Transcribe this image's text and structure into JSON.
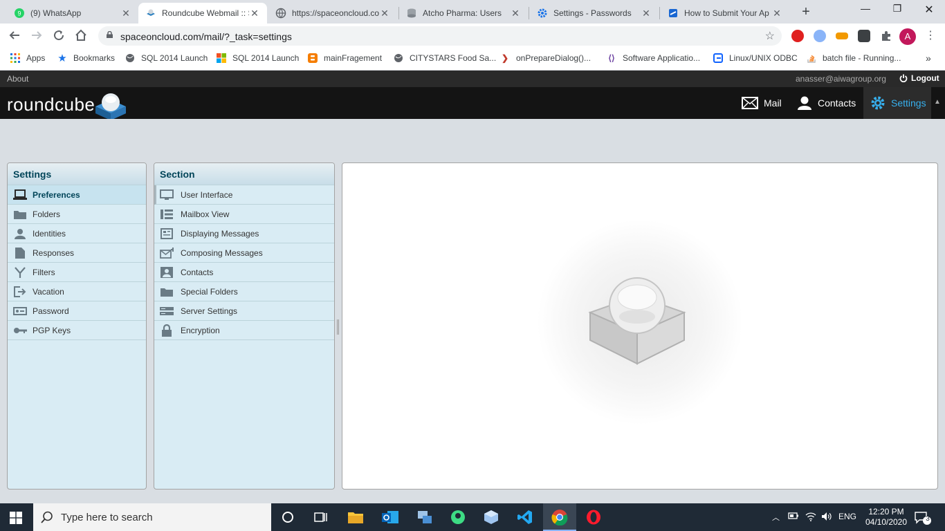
{
  "browser": {
    "tabs": [
      {
        "title": "(9) WhatsApp",
        "close": "✕"
      },
      {
        "title": "Roundcube Webmail :: S",
        "close": "✕"
      },
      {
        "title": "https://spaceoncloud.co",
        "close": "✕"
      },
      {
        "title": "Atcho Pharma: Users",
        "close": "✕"
      },
      {
        "title": "Settings - Passwords",
        "close": "✕"
      },
      {
        "title": "How to Submit Your Ap",
        "close": "✕"
      }
    ],
    "new_tab": "+",
    "window_controls": {
      "minimize": "—",
      "restore": "❐",
      "close": "✕"
    },
    "url": "spaceoncloud.com/mail/?_task=settings",
    "profile_initial": "A",
    "bookmarks": [
      {
        "label": "Apps",
        "icon": "apps-grid-icon"
      },
      {
        "label": "Bookmarks",
        "icon": "star-icon"
      },
      {
        "label": "SQL 2014 Launch",
        "icon": "globe-icon"
      },
      {
        "label": "SQL 2014 Launch",
        "icon": "windows-logo-icon"
      },
      {
        "label": "mainFragement",
        "icon": "blogger-icon"
      },
      {
        "label": "CITYSTARS Food Sa...",
        "icon": "globe-icon"
      },
      {
        "label": "onPrepareDialog()...",
        "icon": "android-icon"
      },
      {
        "label": "Software Applicatio...",
        "icon": "code-icon"
      },
      {
        "label": "Linux/UNIX ODBC",
        "icon": "ibm-icon"
      },
      {
        "label": "batch file - Running...",
        "icon": "stackoverflow-icon"
      }
    ],
    "bookmarks_more": "»"
  },
  "roundcube": {
    "about": "About",
    "user_email": "anasser@aiwagroup.org",
    "logout": "Logout",
    "logo_text": "roundcube",
    "nav": [
      {
        "label": "Mail",
        "icon": "envelope-icon"
      },
      {
        "label": "Contacts",
        "icon": "user-icon"
      },
      {
        "label": "Settings",
        "icon": "gear-icon",
        "selected": true
      }
    ],
    "settings_panel": {
      "title": "Settings",
      "items": [
        {
          "label": "Preferences",
          "icon": "laptop-icon",
          "selected": true
        },
        {
          "label": "Folders",
          "icon": "folder-icon"
        },
        {
          "label": "Identities",
          "icon": "person-icon"
        },
        {
          "label": "Responses",
          "icon": "document-icon"
        },
        {
          "label": "Filters",
          "icon": "filter-icon"
        },
        {
          "label": "Vacation",
          "icon": "exit-icon"
        },
        {
          "label": "Password",
          "icon": "password-icon"
        },
        {
          "label": "PGP Keys",
          "icon": "key-icon"
        }
      ]
    },
    "section_panel": {
      "title": "Section",
      "items": [
        {
          "label": "User Interface",
          "icon": "monitor-icon"
        },
        {
          "label": "Mailbox View",
          "icon": "list-view-icon"
        },
        {
          "label": "Displaying Messages",
          "icon": "message-view-icon"
        },
        {
          "label": "Composing Messages",
          "icon": "compose-icon"
        },
        {
          "label": "Contacts",
          "icon": "contact-card-icon"
        },
        {
          "label": "Special Folders",
          "icon": "folder-icon"
        },
        {
          "label": "Server Settings",
          "icon": "server-icon"
        },
        {
          "label": "Encryption",
          "icon": "lock-icon"
        }
      ]
    }
  },
  "taskbar": {
    "search_placeholder": "Type here to search",
    "language": "ENG",
    "time": "12:20 PM",
    "date": "04/10/2020",
    "notification_count": "3"
  },
  "colors": {
    "accent": "#37b0ee",
    "header_bg": "#141414",
    "panel_bg": "#d9ecf4",
    "selected_item": "#c7e3ef",
    "taskbar_bg": "#1f2a36"
  }
}
